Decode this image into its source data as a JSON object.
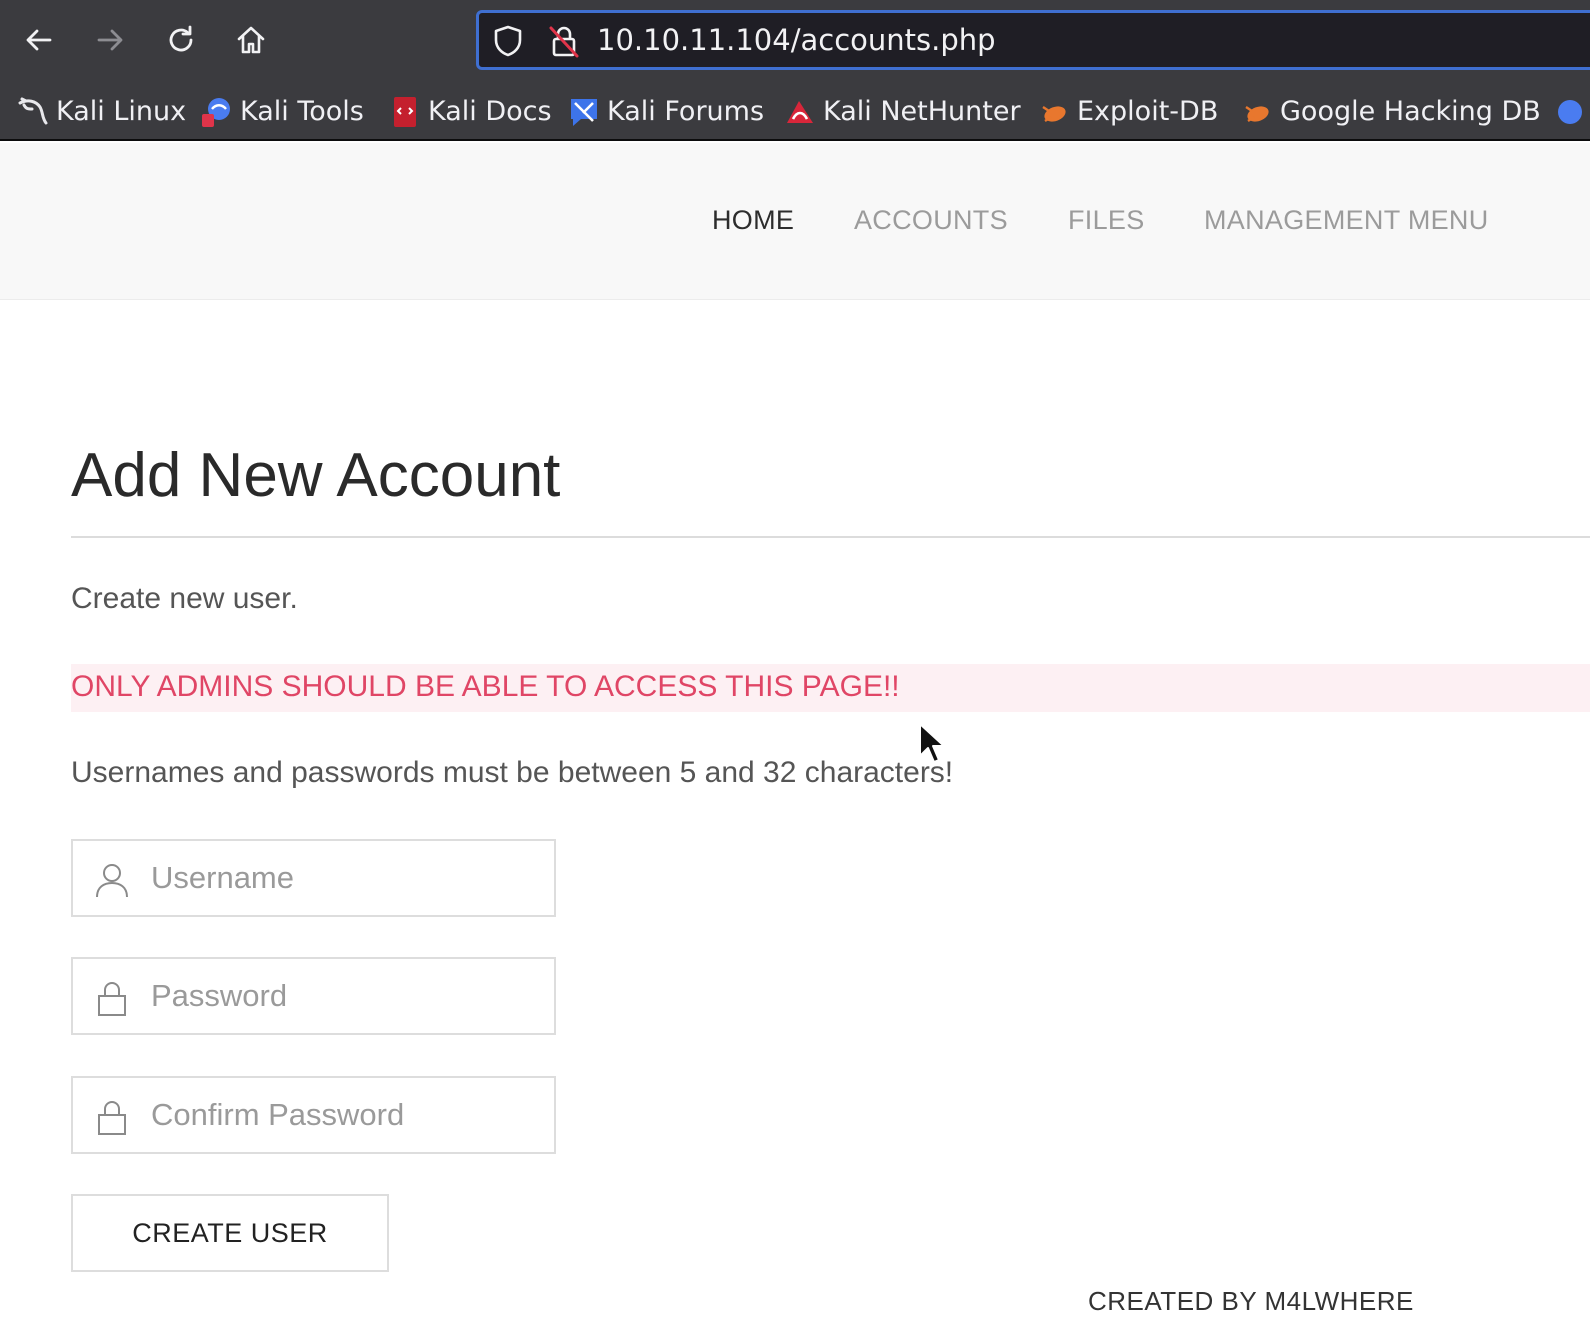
{
  "browser": {
    "url": "10.10.11.104/accounts.php",
    "bookmarks": [
      {
        "label": "Kali Linux",
        "icon": "kali-dragon-icon"
      },
      {
        "label": "Kali Tools",
        "icon": "kali-tools-icon"
      },
      {
        "label": "Kali Docs",
        "icon": "kali-docs-icon"
      },
      {
        "label": "Kali Forums",
        "icon": "kali-forums-icon"
      },
      {
        "label": "Kali NetHunter",
        "icon": "kali-nethunter-icon"
      },
      {
        "label": "Exploit-DB",
        "icon": "exploit-db-icon"
      },
      {
        "label": "Google Hacking DB",
        "icon": "google-hacking-db-icon"
      }
    ]
  },
  "site_nav": {
    "items": [
      {
        "label": "HOME",
        "active": true
      },
      {
        "label": "ACCOUNTS",
        "active": false
      },
      {
        "label": "FILES",
        "active": false
      },
      {
        "label": "MANAGEMENT MENU",
        "active": false
      }
    ]
  },
  "main": {
    "title": "Add New Account",
    "lead": "Create new user.",
    "warning": "ONLY ADMINS SHOULD BE ABLE TO ACCESS THIS PAGE!!",
    "rule": "Usernames and passwords must be between 5 and 32 characters!",
    "fields": {
      "username": {
        "placeholder": "Username",
        "value": ""
      },
      "password": {
        "placeholder": "Password",
        "value": ""
      },
      "confirm": {
        "placeholder": "Confirm Password",
        "value": ""
      }
    },
    "submit_label": "CREATE USER"
  },
  "footer": {
    "credit": "CREATED BY M4LWHERE"
  },
  "colors": {
    "browser_chrome": "#3b3b3f",
    "urlbar_focus": "#3f6fd1",
    "warning_text": "#e04666",
    "warning_bg": "#fdf0f3"
  }
}
